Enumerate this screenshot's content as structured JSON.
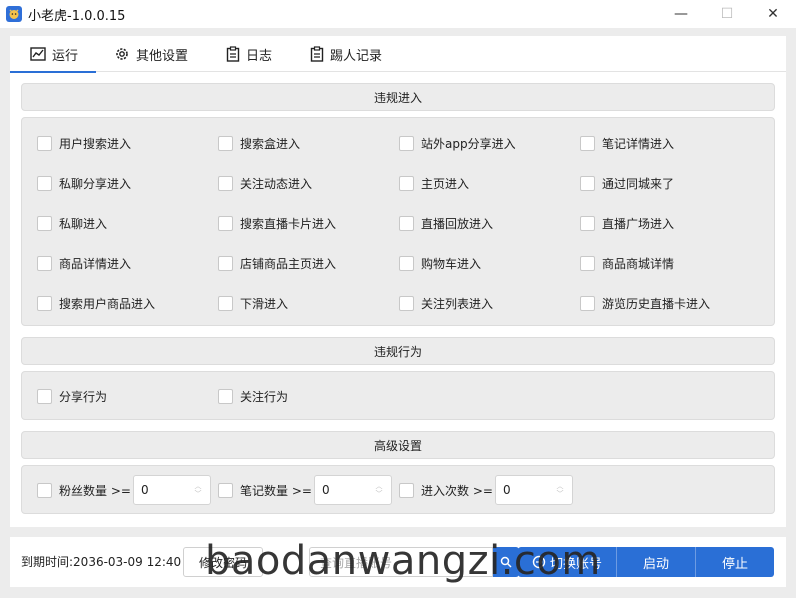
{
  "window": {
    "title": "小老虎-1.0.0.15",
    "minimize": "—",
    "maximize": "☐",
    "close": "✕"
  },
  "tabs": [
    {
      "label": "运行",
      "icon": "chart-icon",
      "active": true
    },
    {
      "label": "其他设置",
      "icon": "gear-icon",
      "active": false
    },
    {
      "label": "日志",
      "icon": "clipboard-icon",
      "active": false
    },
    {
      "label": "踢人记录",
      "icon": "clipboard-icon",
      "active": false
    }
  ],
  "sections": {
    "entry": {
      "title": "违规进入",
      "items": [
        "用户搜索进入",
        "搜索盒进入",
        "站外app分享进入",
        "笔记详情进入",
        "私聊分享进入",
        "关注动态进入",
        "主页进入",
        "通过同城来了",
        "私聊进入",
        "搜索直播卡片进入",
        "直播回放进入",
        "直播广场进入",
        "商品详情进入",
        "店铺商品主页进入",
        "购物车进入",
        "商品商城详情",
        "搜索用户商品进入",
        "下滑进入",
        "关注列表进入",
        "游览历史直播卡进入"
      ]
    },
    "behavior": {
      "title": "违规行为",
      "items": [
        "分享行为",
        "关注行为"
      ]
    },
    "advanced": {
      "title": "高级设置",
      "fields": [
        {
          "label": "粉丝数量 >=",
          "value": "0"
        },
        {
          "label": "笔记数量 >=",
          "value": "0"
        },
        {
          "label": "进入次数 >=",
          "value": "0"
        }
      ]
    }
  },
  "footer": {
    "expire": "到期时间:2036-03-09 12:40",
    "edit_button": "修改密码",
    "search_placeholder": "查询直播账号",
    "buttons": [
      "切换账号",
      "启动",
      "停止"
    ]
  },
  "watermark": "baodanwangzi.com",
  "colors": {
    "accent": "#2a6fd6",
    "section_bg": "#ececec"
  }
}
